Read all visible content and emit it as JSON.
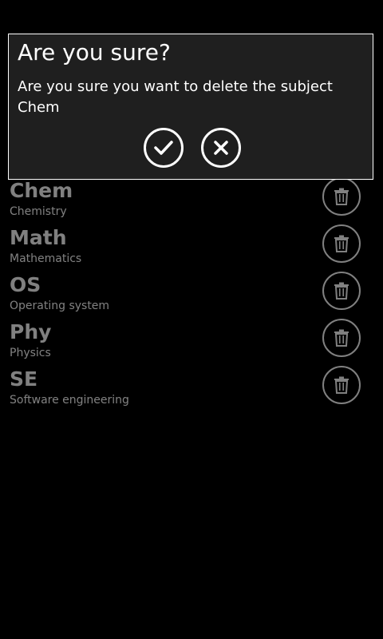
{
  "dialog": {
    "title": "Are you sure?",
    "message": "Are you sure you want to delete the subject Chem",
    "confirm_icon": "checkmark-icon",
    "cancel_icon": "close-icon"
  },
  "subjects": [
    {
      "code": "Chem",
      "name": "Chemistry",
      "action_icon": "trash-icon"
    },
    {
      "code": "Math",
      "name": "Mathematics",
      "action_icon": "trash-icon"
    },
    {
      "code": "OS",
      "name": "Operating system",
      "action_icon": "trash-icon"
    },
    {
      "code": "Phy",
      "name": "Physics",
      "action_icon": "trash-icon"
    },
    {
      "code": "SE",
      "name": "Software engineering",
      "action_icon": "trash-icon"
    }
  ],
  "colors": {
    "background": "#000000",
    "dialog_background": "#1f1f1f",
    "foreground": "#ffffff"
  }
}
